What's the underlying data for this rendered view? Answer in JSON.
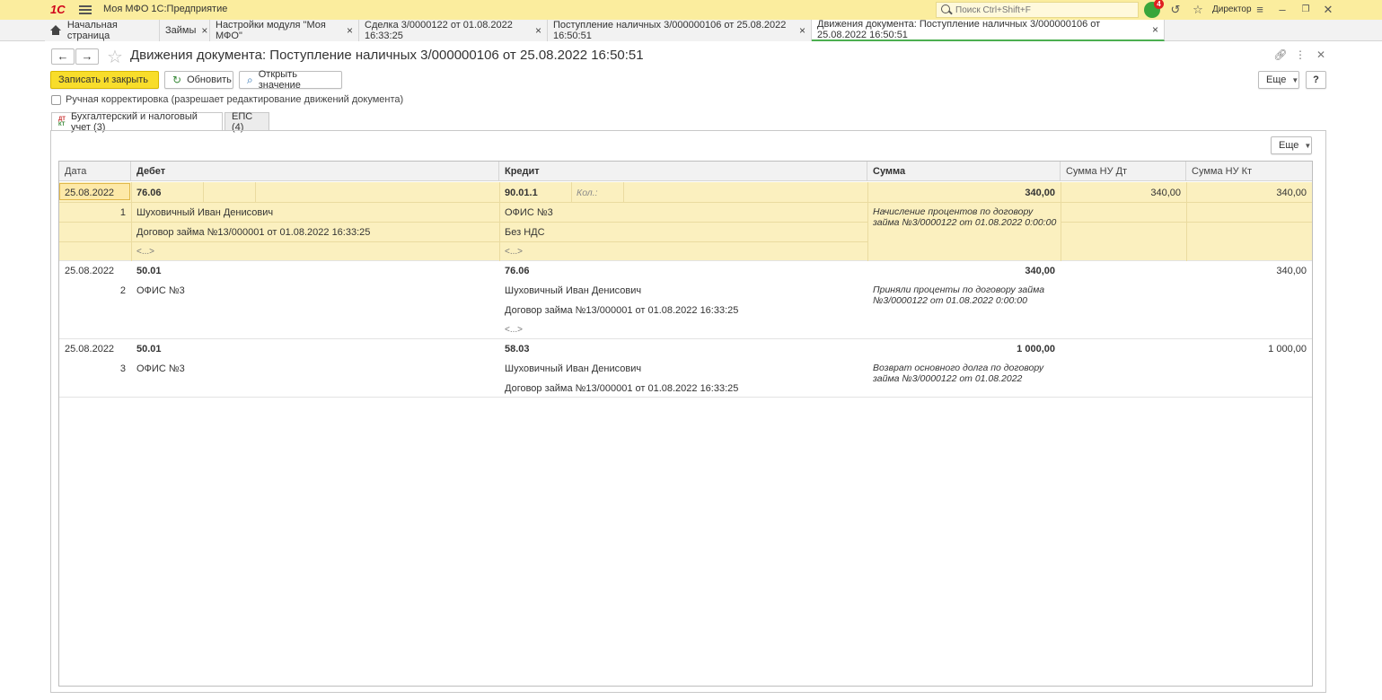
{
  "app": {
    "title": "Моя МФО 1С:Предприятие",
    "logo": "1С",
    "search_placeholder": "Поиск Ctrl+Shift+F",
    "notifications_count": "4",
    "user": "Директор"
  },
  "tabs": [
    {
      "label": "Начальная страница",
      "closable": false
    },
    {
      "label": "Займы",
      "closable": true
    },
    {
      "label": "Настройки модуля \"Моя МФО\"",
      "closable": true
    },
    {
      "label": "Сделка 3/0000122 от 01.08.2022 16:33:25",
      "closable": true
    },
    {
      "label": "Поступление наличных 3/000000106 от 25.08.2022 16:50:51",
      "closable": true
    },
    {
      "label": "Движения документа: Поступление наличных 3/000000106 от 25.08.2022 16:50:51",
      "closable": true,
      "active": true
    }
  ],
  "form": {
    "title": "Движения документа: Поступление наличных 3/000000106 от 25.08.2022 16:50:51",
    "save_close": "Записать и закрыть",
    "refresh": "Обновить",
    "open_value": "Открыть значение",
    "more": "Еще",
    "help": "?",
    "manual_edit": "Ручная корректировка (разрешает редактирование движений документа)"
  },
  "inner_tabs": [
    {
      "label": "Бухгалтерский и налоговый учет (3)",
      "active": true
    },
    {
      "label": "ЕПС (4)",
      "active": false
    }
  ],
  "grid": {
    "more": "Еще",
    "columns": [
      "Дата",
      "Дебет",
      "Кредит",
      "Сумма",
      "Сумма НУ Дт",
      "Сумма НУ Кт"
    ],
    "rows": [
      {
        "date": "25.08.2022",
        "num": "1",
        "debit": "76.06",
        "debit_sub1": "Шуховичный Иван Денисович",
        "debit_sub2": "Договор займа №13/000001 от 01.08.2022 16:33:25",
        "debit_more": "<...>",
        "credit": "90.01.1",
        "credit_kol": "Кол.:",
        "credit_sub1": "ОФИС №3",
        "credit_sub2": "Без НДС",
        "credit_more": "<...>",
        "sum": "340,00",
        "content": "Начисление процентов по договору займа №3/0000122 от 01.08.2022 0:00:00",
        "nu_dt": "340,00",
        "nu_kt": "340,00"
      },
      {
        "date": "25.08.2022",
        "num": "2",
        "debit": "50.01",
        "debit_sub1": "ОФИС №3",
        "credit": "76.06",
        "credit_sub1": "Шуховичный Иван Денисович",
        "credit_sub2": "Договор займа №13/000001 от 01.08.2022 16:33:25",
        "credit_more": "<...>",
        "sum": "340,00",
        "content": "Приняли проценты по договору займа №3/0000122 от 01.08.2022 0:00:00",
        "nu_dt": "",
        "nu_kt": "340,00"
      },
      {
        "date": "25.08.2022",
        "num": "3",
        "debit": "50.01",
        "debit_sub1": "ОФИС №3",
        "credit": "58.03",
        "credit_sub1": "Шуховичный Иван Денисович",
        "credit_sub2": "Договор займа №13/000001 от 01.08.2022 16:33:25",
        "sum": "1 000,00",
        "content": "Возврат основного долга по договору займа №3/0000122 от 01.08.2022",
        "nu_dt": "",
        "nu_kt": "1 000,00"
      }
    ]
  }
}
